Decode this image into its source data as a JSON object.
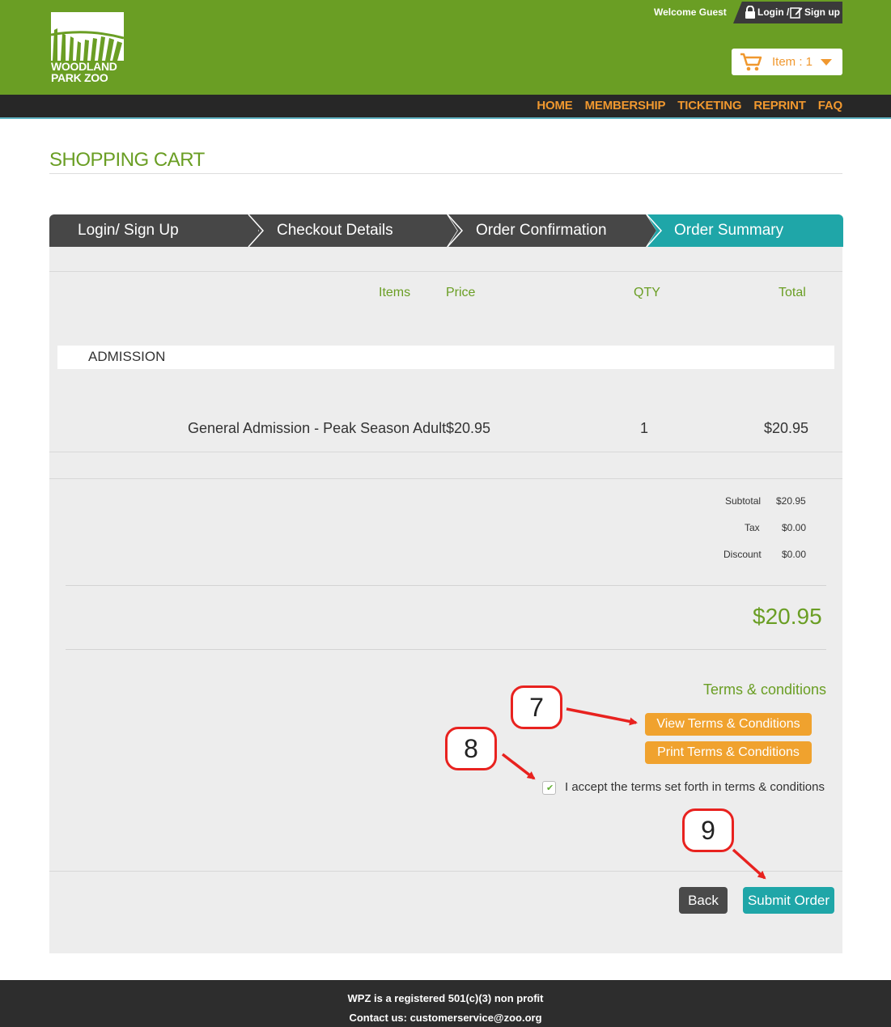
{
  "header": {
    "logo_line1": "WOODLAND",
    "logo_line2": "PARK ZOO",
    "welcome": "Welcome Guest",
    "login": "Login /",
    "signup": "Sign up",
    "cart_label": "Item : 1"
  },
  "nav": [
    "HOME",
    "MEMBERSHIP",
    "TICKETING",
    "REPRINT",
    "FAQ"
  ],
  "page_title": "SHOPPING CART",
  "steps": [
    "Login/ Sign Up",
    "Checkout Details",
    "Order Confirmation",
    "Order Summary"
  ],
  "table": {
    "headers": {
      "items": "Items",
      "price": "Price",
      "qty": "QTY",
      "total": "Total"
    },
    "category": "ADMISSION",
    "rows": [
      {
        "item": "General Admission - Peak Season Adult",
        "price": "$20.95",
        "qty": "1",
        "total": "$20.95"
      }
    ]
  },
  "summary": {
    "subtotal_label": "Subtotal",
    "subtotal": "$20.95",
    "tax_label": "Tax",
    "tax": "$0.00",
    "discount_label": "Discount",
    "discount": "$0.00",
    "grand_total": "$20.95"
  },
  "terms": {
    "title": "Terms & conditions",
    "view_button": "View Terms & Conditions",
    "print_button": "Print Terms & Conditions",
    "accept_text": "I accept the terms set forth in terms & conditions",
    "accepted": true
  },
  "actions": {
    "back": "Back",
    "submit": "Submit Order"
  },
  "annotations": {
    "step7": "7",
    "step8": "8",
    "step9": "9"
  },
  "footer": {
    "line1": "WPZ is a registered 501(c)(3) non profit",
    "line2": "Contact us: customerservice@zoo.org"
  },
  "colors": {
    "brand_green": "#6a9e24",
    "accent_orange": "#f0a22e",
    "teal": "#1fa6a8",
    "dark": "#272727",
    "annotation_red": "#e8221f"
  }
}
